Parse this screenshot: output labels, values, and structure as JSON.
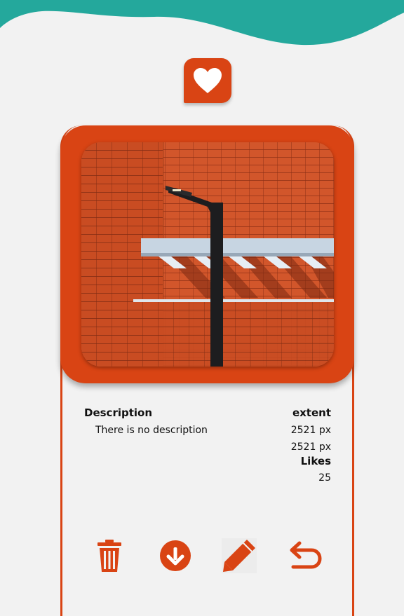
{
  "colors": {
    "accent": "#d94414",
    "teal": "#24a89c",
    "background": "#f2f2f2"
  },
  "header": {
    "logo_icon": "heart-icon"
  },
  "photo": {
    "alt": "Orange brick wall with a black street lamp and a white canopy"
  },
  "details": {
    "description_heading": "Description",
    "description_text": "There is no description",
    "extent_heading": "extent",
    "width": "2521 px",
    "height": "2521 px",
    "likes_heading": "Likes",
    "likes_count": "25"
  },
  "actions": [
    {
      "icon": "trash-icon"
    },
    {
      "icon": "download-icon"
    },
    {
      "icon": "pencil-icon"
    },
    {
      "icon": "undo-icon"
    }
  ]
}
